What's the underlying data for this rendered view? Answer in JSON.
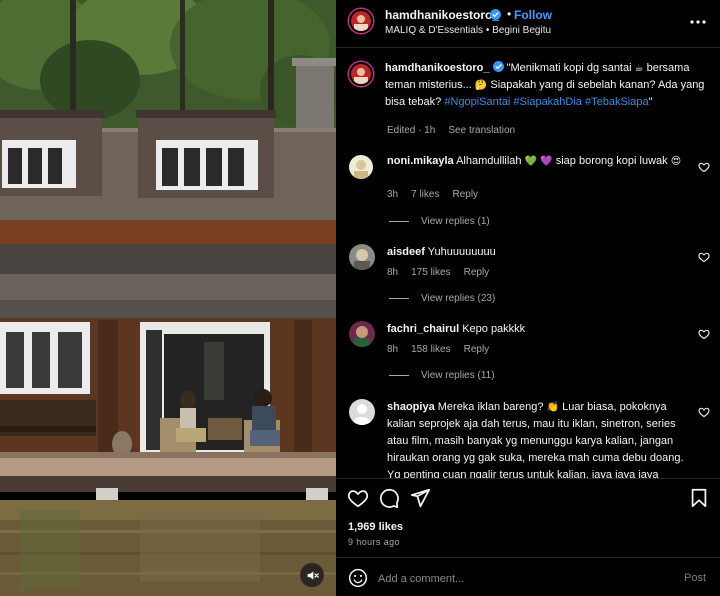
{
  "header": {
    "username": "hamdhanikoestoro_",
    "follow_label": "Follow",
    "dot": "•",
    "audio_label": "MALIQ & D'Essentials • Begini Begitu"
  },
  "caption": {
    "username": "hamdhanikoestoro_",
    "text_1": " \"Menikmati kopi dg santai ",
    "text_2": " bersama teman misterius... ",
    "text_3": " Siapakah yang di sebelah kanan? Ada yang bisa tebak? ",
    "hashtags_a": "#NgopiSantai #SiapakahDia",
    "hashtags_b": "#TebakSiapa",
    "text_end": "\"",
    "meta_edited": "Edited · 1h",
    "meta_translate": "See translation",
    "emoji_coffee": "☕",
    "emoji_think": "🤔"
  },
  "comments": [
    {
      "username": "noni.mikayla",
      "text": " Alhamdullilah ",
      "emoji_after": "💚 💜",
      "text_after": " siap borong kopi luwak ",
      "emoji_end": "😍",
      "time": "3h",
      "likes": "7 likes",
      "reply": "Reply",
      "view_replies": "View replies (1)"
    },
    {
      "username": "aisdeef",
      "text": " Yuhuuuuuuuu",
      "time": "8h",
      "likes": "175 likes",
      "reply": "Reply",
      "view_replies": "View replies (23)"
    },
    {
      "username": "fachri_chairul",
      "text": " Kepo pakkkk",
      "time": "8h",
      "likes": "158 likes",
      "reply": "Reply",
      "view_replies": "View replies (11)"
    },
    {
      "username": "shaopiya",
      "text": " Mereka iklan bareng? ",
      "emoji_after": "👏",
      "text_after": " Luar biasa, pokoknya kalian seprojek aja dah terus, mau itu iklan, sinetron, series atau film, masih banyak yg menunggu karya kalian, jangan hiraukan orang yg gak suka, mereka mah cuma debu doang. Yg penting cuan ngalir terus untuk kalian, jaya jaya jaya pokoknya mah"
    }
  ],
  "footer": {
    "likes": "1,969 likes",
    "time_ago": "9 hours ago",
    "comment_placeholder": "Add a comment...",
    "post_label": "Post"
  },
  "icons": {
    "verified": "verified-badge-icon",
    "more": "more-options-icon",
    "heart": "heart-icon",
    "comment": "comment-icon",
    "share": "share-icon",
    "bookmark": "bookmark-icon",
    "emoji": "emoji-icon",
    "mute": "muted-speaker-icon"
  },
  "colors": {
    "background": "#000000",
    "link_blue": "#4a9cf5",
    "hashtag_blue": "#3f8ddf",
    "secondary_text": "#a8a8a8",
    "separator": "#262626"
  }
}
